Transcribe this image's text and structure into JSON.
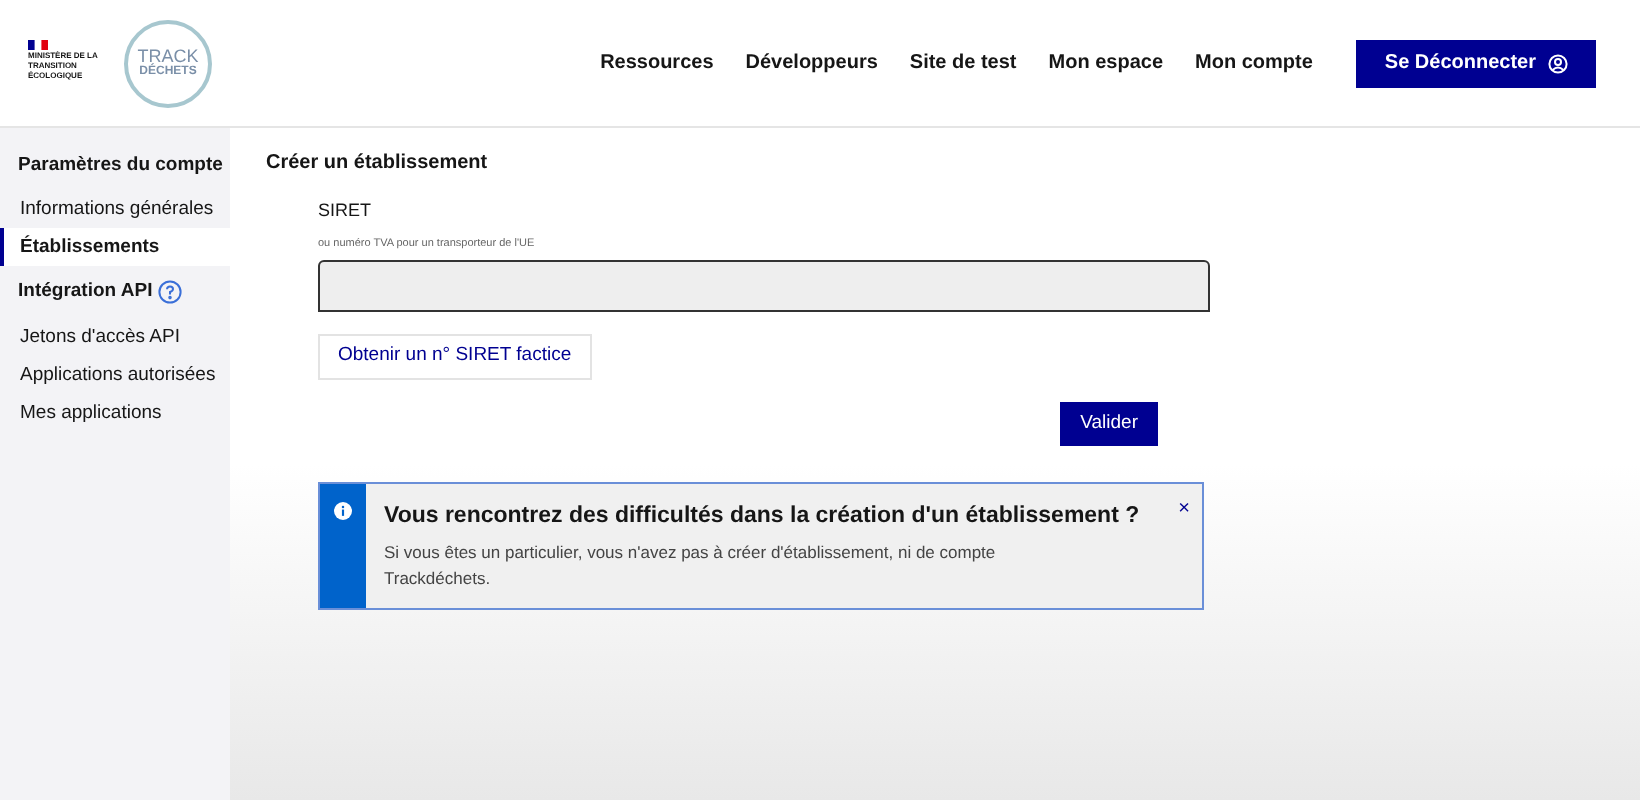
{
  "header": {
    "ministry": "MINISTÈRE DE LA TRANSITION ÉCOLOGIQUE",
    "logo_top": "TRACK",
    "logo_bottom": "DÉCHETS",
    "nav": [
      "Ressources",
      "Développeurs",
      "Site de test",
      "Mon espace",
      "Mon compte"
    ],
    "logout_button": "Se Déconnecter"
  },
  "sidebar": {
    "sections": [
      {
        "title": "Paramètres du compte",
        "help": false,
        "items": [
          {
            "label": "Informations générales",
            "selected": false
          },
          {
            "label": "Établissements",
            "selected": true
          }
        ]
      },
      {
        "title": "Intégration API",
        "help": true,
        "items": [
          {
            "label": "Jetons d'accès API",
            "selected": false
          },
          {
            "label": "Applications autorisées",
            "selected": false
          },
          {
            "label": "Mes applications",
            "selected": false
          }
        ]
      }
    ]
  },
  "main": {
    "title": "Créer un établissement",
    "field_label": "SIRET",
    "field_hint": "ou numéro TVA pour un transporteur de l'UE",
    "fake_siret_button": "Obtenir un n° SIRET factice",
    "submit_button": "Valider",
    "notice": {
      "title": "Vous rencontrez des difficultés dans la création d'un établissement ?",
      "body": "Si vous êtes un particulier, vous n'avez pas à créer d'établissement, ni de compte Trackdéchets.",
      "close": "×"
    }
  }
}
